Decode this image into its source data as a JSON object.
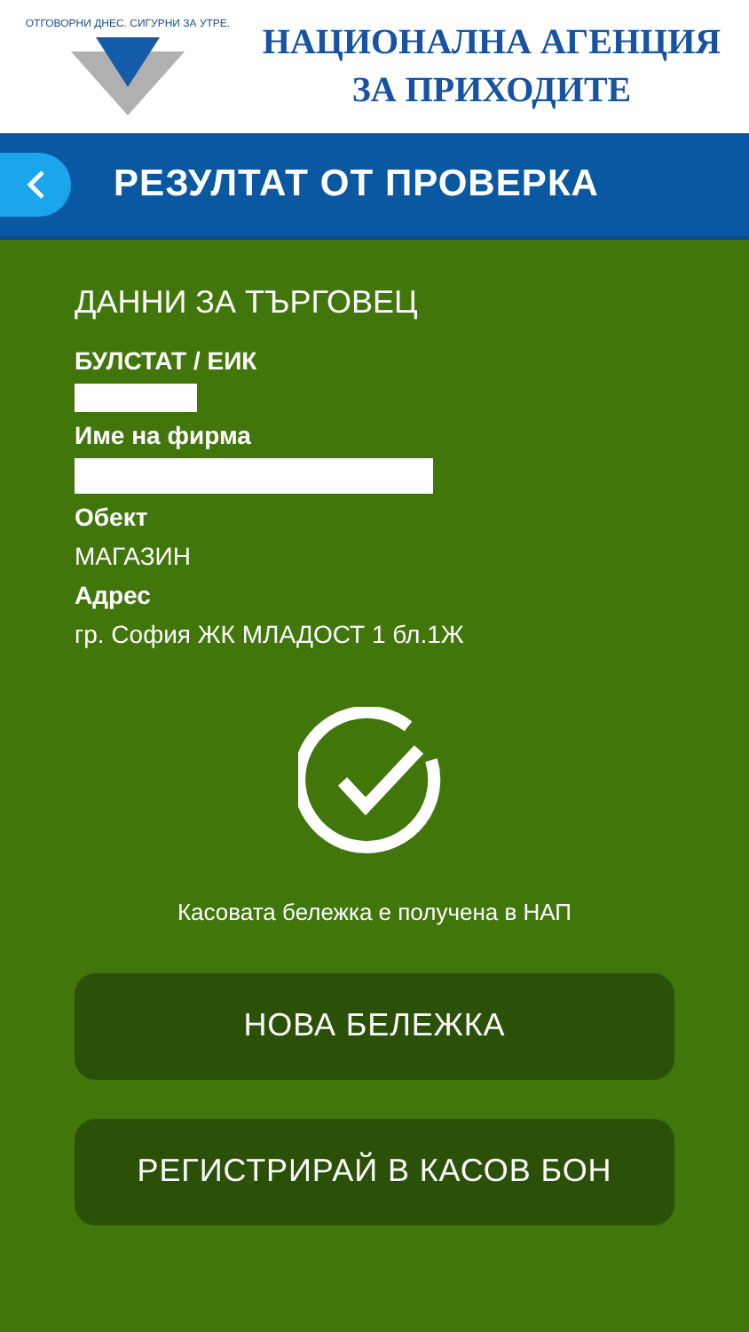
{
  "header": {
    "slogan": "ОТГОВОРНИ ДНЕС. СИГУРНИ ЗА УТРЕ.",
    "agency_name": [
      "НАЦИОНАЛНА АГЕНЦИЯ",
      "ЗА ПРИХОДИТЕ"
    ]
  },
  "title_bar": {
    "title": "РЕЗУЛТАТ ОТ ПРОВЕРКА"
  },
  "merchant": {
    "heading": "ДАННИ ЗА ТЪРГОВЕЦ",
    "fields": [
      {
        "label": "БУЛСТАТ / ЕИК",
        "kind": "redacted_short"
      },
      {
        "label": "Име на фирма",
        "kind": "redacted_long"
      },
      {
        "label": "Обект",
        "kind": "text",
        "value": "МАГАЗИН"
      },
      {
        "label": "Адрес",
        "kind": "text",
        "value": "гр. София ЖК МЛАДОСТ 1 бл.1Ж"
      }
    ]
  },
  "status_message": "Касовата бележка е получена в НАП",
  "buttons": [
    "НОВА БЕЛЕЖКА",
    "РЕГИСТРИРАЙ В КАСОВ БОН"
  ]
}
